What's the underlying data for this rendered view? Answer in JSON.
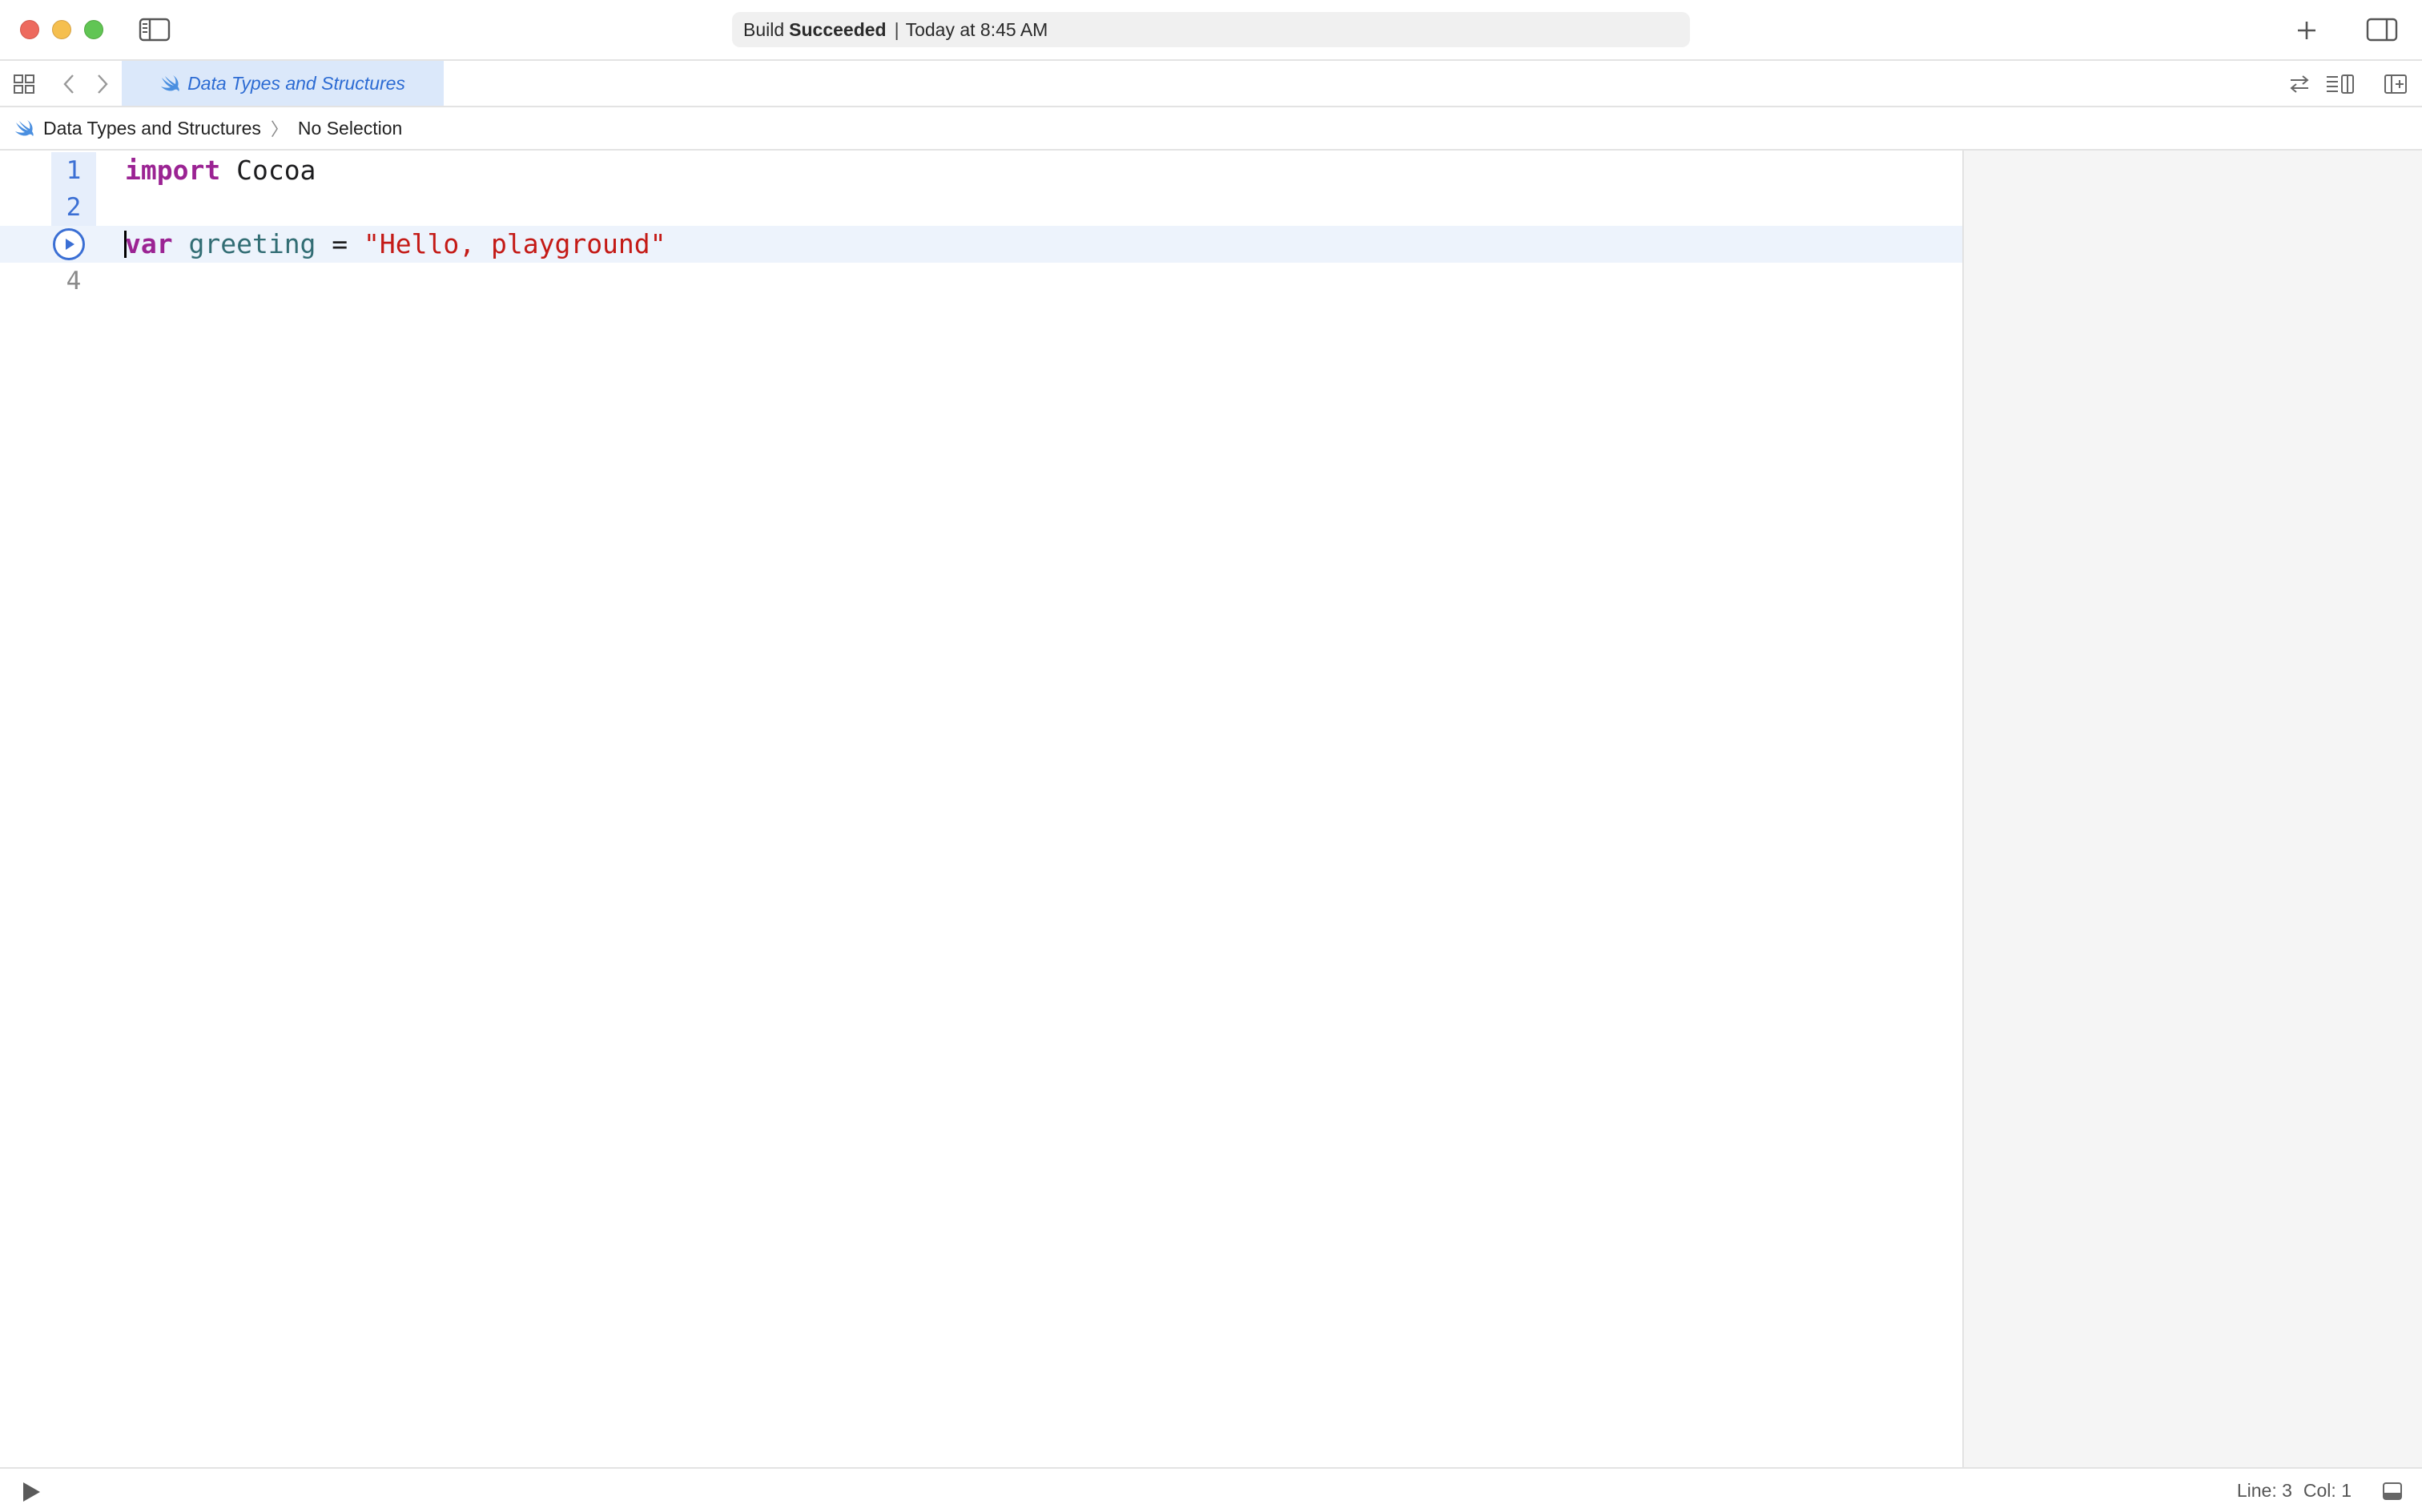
{
  "window": {
    "status": {
      "prefix": "Build",
      "state": "Succeeded",
      "separator": "|",
      "time": "Today at 8:45 AM"
    }
  },
  "tabs": [
    {
      "label": "Data Types and Structures",
      "icon": "swift-icon",
      "active": true
    }
  ],
  "jumpbar": {
    "file": "Data Types and Structures",
    "separator": "〉",
    "selection": "No Selection"
  },
  "editor": {
    "current_line": 3,
    "lines": [
      {
        "number": "1",
        "tokens": {
          "kw": "import",
          "rest": " Cocoa"
        }
      },
      {
        "number": "2",
        "tokens": {}
      },
      {
        "number": "3",
        "tokens": {
          "kw": "var",
          "sp": " ",
          "name": "greeting",
          "op": " = ",
          "str": "\"Hello, playground\""
        }
      },
      {
        "number": "4",
        "tokens": {}
      }
    ]
  },
  "statusbar": {
    "line": "Line: 3",
    "col": "Col: 1"
  },
  "colors": {
    "accent": "#3b6fd4",
    "keyword": "#9b2393",
    "variable": "#326d74",
    "string": "#c41a16",
    "current_line_bg": "#edf3fc",
    "tab_bg": "#dbe8fa"
  }
}
